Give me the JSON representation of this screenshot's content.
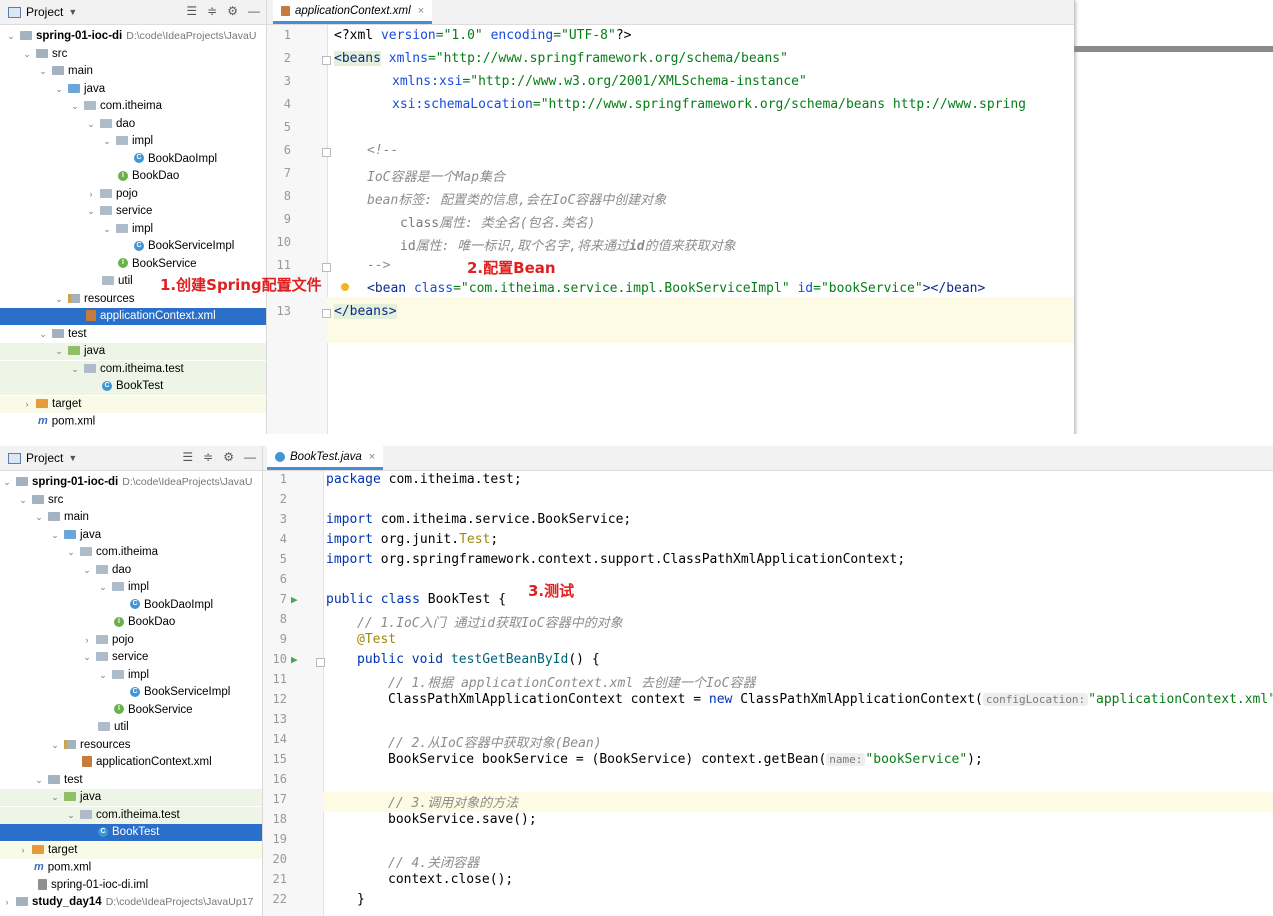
{
  "project_pane": {
    "title": "Project",
    "project_name": "spring-01-ioc-di",
    "project_path": "D:\\code\\IdeaProjects\\JavaU",
    "project_path_short": "D:\\code\\IdeaProjects\\JavaU",
    "items": {
      "src": "src",
      "main": "main",
      "java": "java",
      "pkg": "com.itheima",
      "dao": "dao",
      "impl": "impl",
      "bookdaoimpl": "BookDaoImpl",
      "bookdao": "BookDao",
      "pojo": "pojo",
      "service": "service",
      "bookserviceimpl": "BookServiceImpl",
      "bookservice": "BookService",
      "util": "util",
      "resources": "resources",
      "appctx": "applicationContext.xml",
      "test": "test",
      "testpkg": "com.itheima.test",
      "booktest": "BookTest",
      "target": "target",
      "pom": "pom.xml",
      "iml": "spring-01-ioc-di.iml",
      "study": "study_day14",
      "study_path": "D:\\code\\IdeaProjects\\JavaUp17"
    }
  },
  "editor_top": {
    "tab": "applicationContext.xml",
    "lines": {
      "l1_a": "<?xml ",
      "l1_b": "version",
      "l1_c": "=\"1.0\" ",
      "l1_d": "encoding",
      "l1_e": "=\"UTF-8\"",
      "l1_f": "?>",
      "l2_tag": "<beans",
      "l2_attr": " xmlns",
      "l2_str": "=\"http://www.springframework.org/schema/beans\"",
      "l3_attr": "xmlns:xsi",
      "l3_str": "=\"http://www.w3.org/2001/XMLSchema-instance\"",
      "l4_attr": "xsi:schemaLocation",
      "l4_str": "=\"http://www.springframework.org/schema/beans http://www.spring",
      "l6": "<!--",
      "l7": "IoC容器是一个Map集合",
      "l8": "bean标签: 配置类的信息,会在IoC容器中创建对象",
      "l9_a": "class",
      "l9_b": "属性: 类全名(包名.类名)",
      "l10_a": "id",
      "l10_b": "属性: 唯一标识,取个名字,将来通过",
      "l10_c": "id",
      "l10_d": "的值来获取对象",
      "l11": "-->",
      "l12_tag": "<bean",
      "l12_attr1": " class",
      "l12_str1": "=\"com.itheima.service.impl.BookServiceImpl\"",
      "l12_attr2": " id",
      "l12_str2": "=\"bookService\"",
      "l12_end": "></bean>",
      "l13": "</beans>"
    },
    "annotation_1": "1.创建Spring配置文件",
    "annotation_2": "2.配置Bean"
  },
  "editor_bottom": {
    "tab": "BookTest.java",
    "lines": {
      "l1_kw": "package",
      "l1": " com.itheima.test;",
      "l3_kw": "import",
      "l3": " com.itheima.service.BookService;",
      "l4_kw": "import",
      "l4_a": " org.junit.",
      "l4_b": "Test",
      "l4_c": ";",
      "l5_kw": "import",
      "l5": " org.springframework.context.support.ClassPathXmlApplicationContext;",
      "l7_kw1": "public",
      "l7_kw2": " class",
      "l7": " BookTest {",
      "l8": "// 1.IoC入门 通过id获取IoC容器中的对象",
      "l9": "@Test",
      "l10_kw1": "public",
      "l10_kw2": " void",
      "l10_m": " testGetBeanById",
      "l10": "() {",
      "l11": "// 1.根据 applicationContext.xml 去创建一个IoC容器",
      "l12_a": "ClassPathXmlApplicationContext context = ",
      "l12_kw": "new",
      "l12_b": " ClassPathXmlApplicationContext(",
      "l12_hint": "configLocation:",
      "l12_str": "\"applicationContext.xml\"",
      "l12_c": ");",
      "l14": "// 2.从IoC容器中获取对象(Bean)",
      "l15_a": "BookService bookService = (BookService) context.getBean(",
      "l15_hint": "name:",
      "l15_str": "\"bookService\"",
      "l15_c": ");",
      "l17": "// 3.调用对象的方法",
      "l18": "bookService.save();",
      "l20": "// 4.关闭容器",
      "l21": "context.close();",
      "l22": "}"
    },
    "annotation_3": "3.测试"
  },
  "line_numbers": [
    "1",
    "2",
    "3",
    "4",
    "5",
    "6",
    "7",
    "8",
    "9",
    "10",
    "11",
    "12",
    "13",
    "14",
    "15",
    "16",
    "17",
    "18",
    "19",
    "20",
    "21",
    "22"
  ]
}
